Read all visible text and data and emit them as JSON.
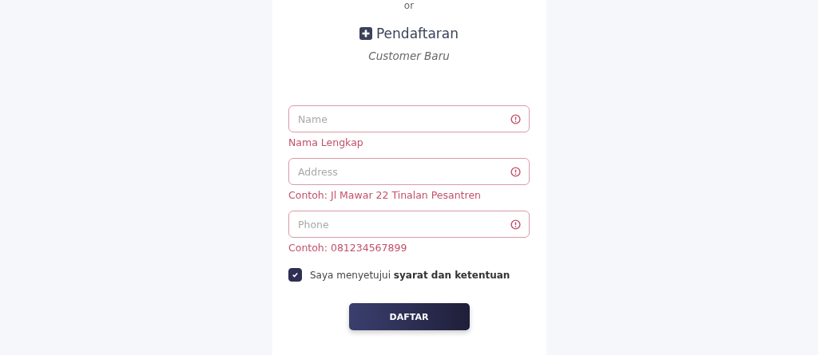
{
  "divider_text": "or",
  "heading": {
    "title": "Pendaftaran",
    "subtitle": "Customer Baru"
  },
  "fields": [
    {
      "placeholder": "Name",
      "invalid": true,
      "helper": "Nama Lengkap"
    },
    {
      "placeholder": "Address",
      "invalid": true,
      "helper": "Contoh: Jl Mawar 22 Tinalan Pesantren"
    },
    {
      "placeholder": "Phone",
      "invalid": true,
      "helper": "Contoh: 081234567899"
    }
  ],
  "agreement": {
    "checked": true,
    "text": "Saya menyetujui **syarat dan ketentuan**"
  },
  "submit_button": "DAFTAR"
}
